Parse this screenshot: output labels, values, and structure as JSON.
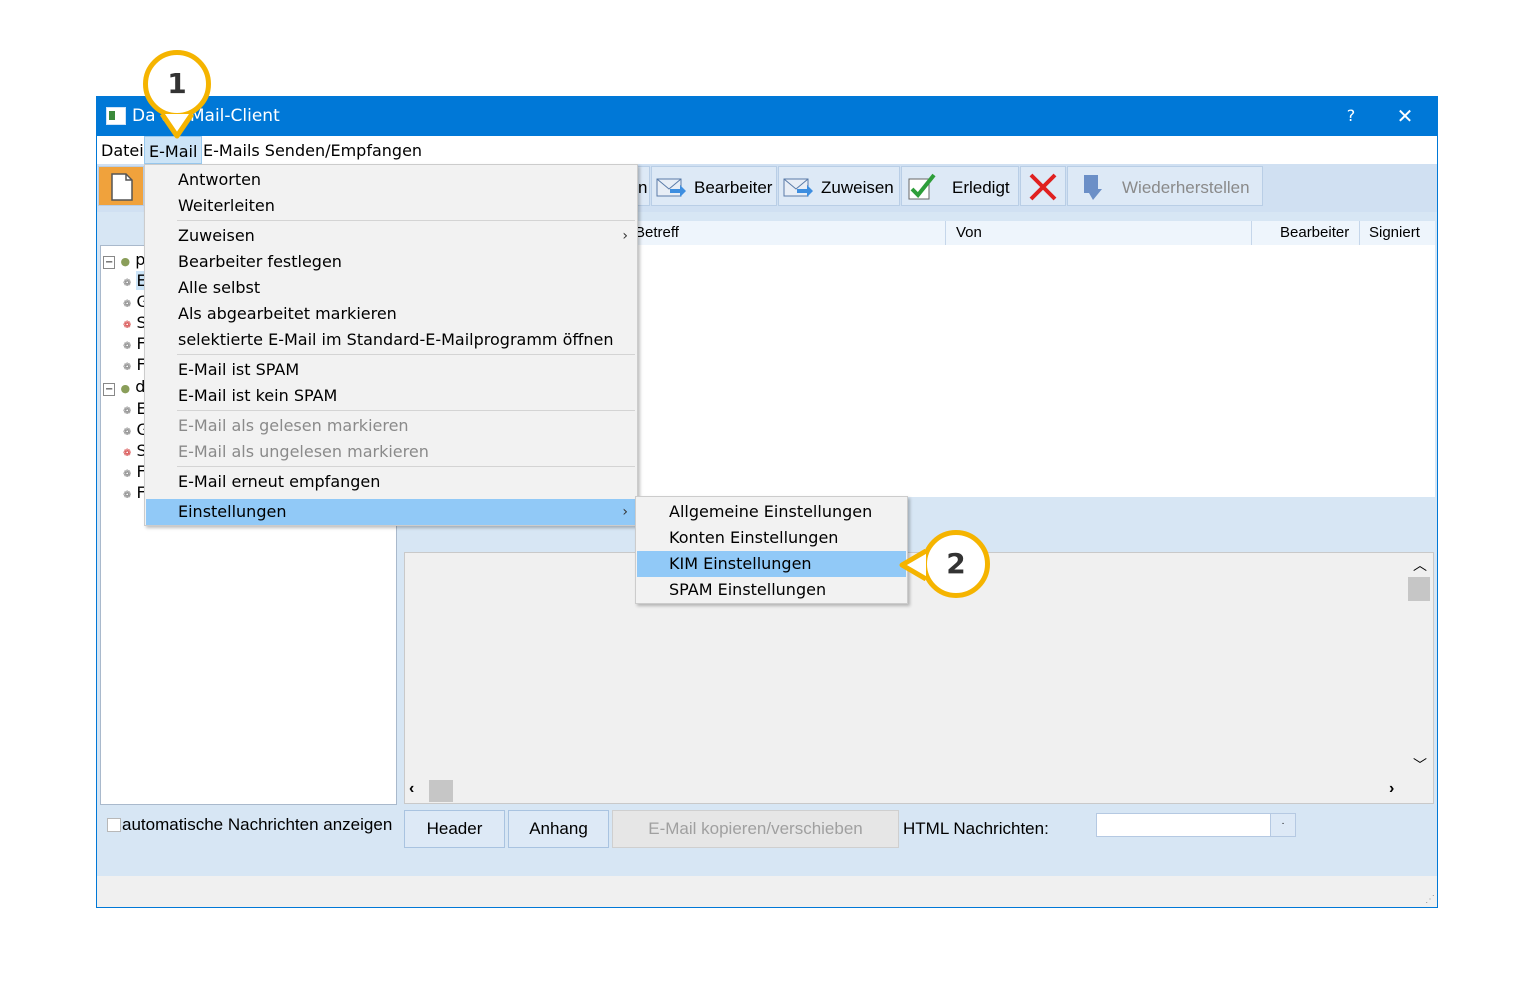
{
  "window": {
    "title": "Dampsoft E-Mail-Client",
    "title_visible": "Da     t E-Mail-Client",
    "help": "?",
    "close": "✕"
  },
  "menubar": [
    "Datei",
    "E-Mail",
    "E-Mails Senden/Empfangen"
  ],
  "toolbar": {
    "partial": "n",
    "buttons": [
      "Bearbeiter",
      "Zuweisen",
      "Erledigt",
      "",
      "Wiederherstellen"
    ]
  },
  "tree": {
    "rows": [
      {
        "label": "pra",
        "level": 0
      },
      {
        "label": "E",
        "level": 1
      },
      {
        "label": "G",
        "level": 1
      },
      {
        "label": "S",
        "level": 1
      },
      {
        "label": "F",
        "level": 1
      },
      {
        "label": "F",
        "level": 1
      },
      {
        "label": "da",
        "level": 0
      },
      {
        "label": "E",
        "level": 1
      },
      {
        "label": "G",
        "level": 1
      },
      {
        "label": "S",
        "level": 1
      },
      {
        "label": "F",
        "level": 1
      },
      {
        "label": "F",
        "level": 1
      }
    ]
  },
  "list": {
    "columns": [
      "Betreff",
      "Von",
      "Bearbeiter",
      "Signiert"
    ]
  },
  "email_menu": {
    "items": [
      {
        "label": "Antworten"
      },
      {
        "label": "Weiterleiten"
      },
      {
        "label": "Zuweisen",
        "submenu": true
      },
      {
        "label": "Bearbeiter festlegen"
      },
      {
        "label": "Alle selbst"
      },
      {
        "label": "Als abgearbeitet markieren"
      },
      {
        "label": "selektierte E-Mail im Standard-E-Mailprogramm öffnen"
      },
      {
        "label": "E-Mail ist SPAM"
      },
      {
        "label": "E-Mail ist kein SPAM"
      },
      {
        "label": "E-Mail als gelesen markieren",
        "disabled": true
      },
      {
        "label": "E-Mail als ungelesen markieren",
        "disabled": true
      },
      {
        "label": "E-Mail erneut empfangen"
      },
      {
        "label": "Einstellungen",
        "submenu": true,
        "highlighted": true
      }
    ],
    "arrow": "›"
  },
  "settings_submenu": {
    "items": [
      {
        "label": "Allgemeine Einstellungen"
      },
      {
        "label": "Konten Einstellungen"
      },
      {
        "label": "KIM Einstellungen",
        "highlighted": true
      },
      {
        "label": "SPAM Einstellungen"
      }
    ]
  },
  "bottom": {
    "checkbox_label": "automatische Nachrichten anzeigen",
    "header_button": "Header",
    "attachment_button": "Anhang",
    "copy_move_button": "E-Mail kopieren/verschieben",
    "html_label": "HTML Nachrichten:",
    "html_select_value": ""
  },
  "callouts": [
    "1",
    "2"
  ],
  "colors": {
    "titlebar": "#0078d7",
    "highlight": "#91c9f7",
    "callout": "#f5b400",
    "window_bg": "#d7e6f4"
  }
}
